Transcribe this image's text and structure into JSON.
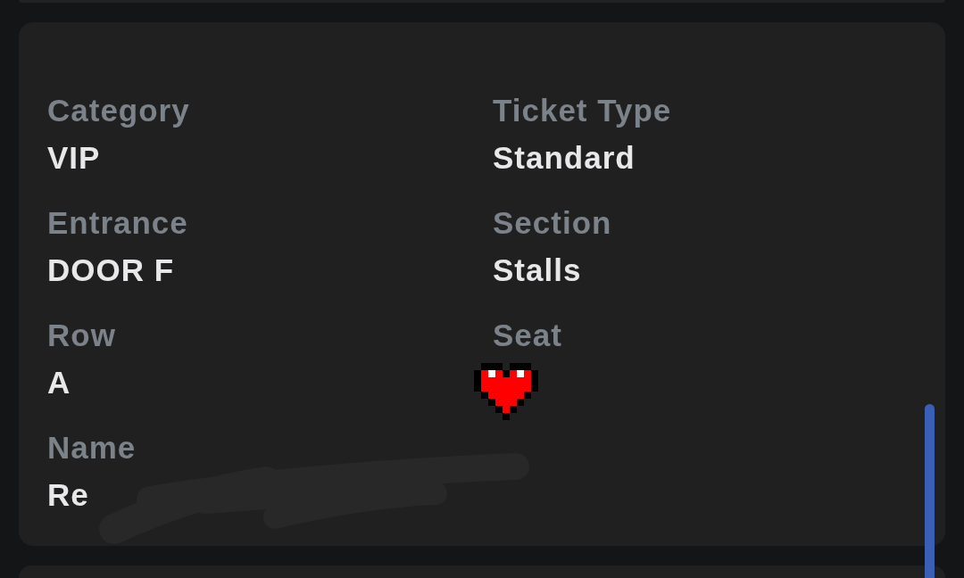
{
  "ticket_details": {
    "fields": [
      {
        "label": "Category",
        "kind": "text",
        "value": "VIP"
      },
      {
        "label": "Ticket Type",
        "kind": "text",
        "value": "Standard"
      },
      {
        "label": "Entrance",
        "kind": "text",
        "value": "DOOR F"
      },
      {
        "label": "Section",
        "kind": "text",
        "value": "Stalls"
      },
      {
        "label": "Row",
        "kind": "text",
        "value": "A"
      },
      {
        "label": "Seat",
        "kind": "sticker"
      },
      {
        "label": "Name",
        "kind": "redacted",
        "value": "Re"
      }
    ]
  }
}
